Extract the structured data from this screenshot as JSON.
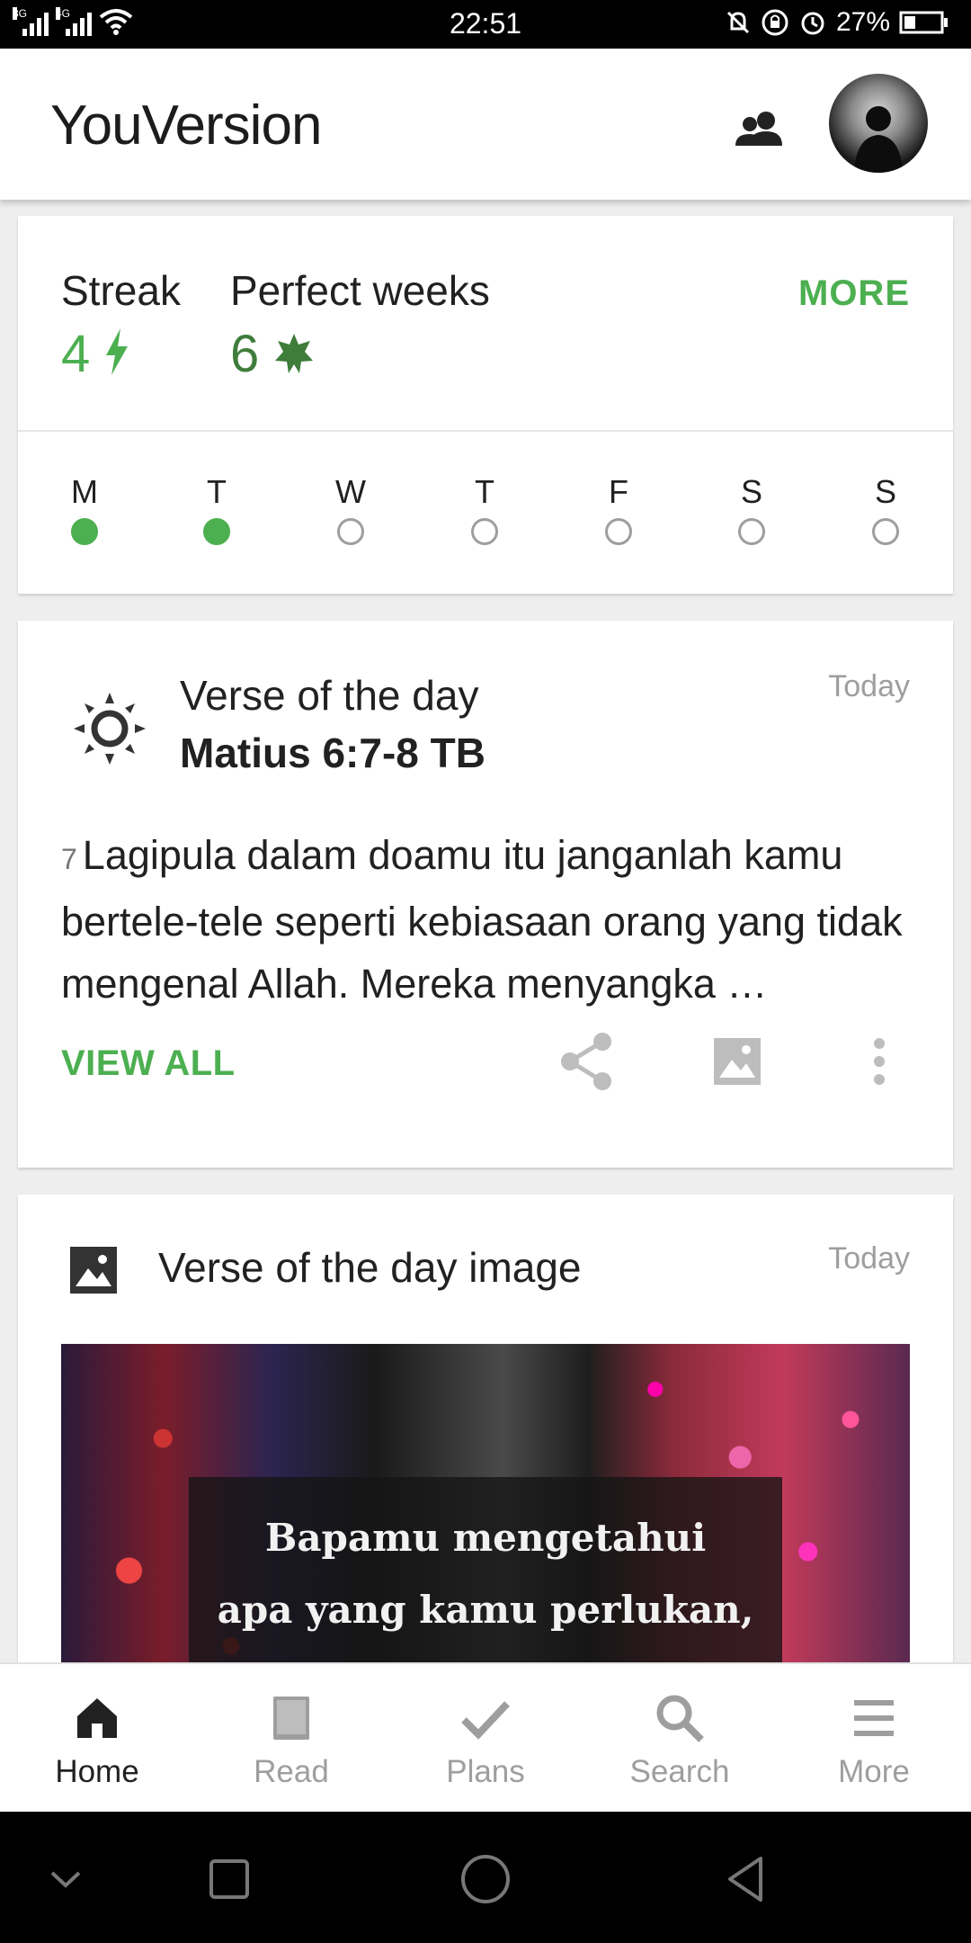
{
  "status_bar": {
    "time": "22:51",
    "network_1": "3G",
    "network_2": "4G",
    "battery": "27%",
    "icons": [
      "signal-icon",
      "wifi-icon",
      "mute-icon",
      "lock-rotation-icon",
      "alarm-icon",
      "battery-icon"
    ]
  },
  "app_bar": {
    "logo": "YouVersion",
    "icons": [
      "friends-icon",
      "avatar"
    ]
  },
  "streak_card": {
    "streak_label": "Streak",
    "streak_value": "4",
    "perfect_label": "Perfect weeks",
    "perfect_value": "6",
    "more_label": "MORE",
    "days": [
      {
        "letter": "M",
        "done": true
      },
      {
        "letter": "T",
        "done": true
      },
      {
        "letter": "W",
        "done": false
      },
      {
        "letter": "T",
        "done": false
      },
      {
        "letter": "F",
        "done": false
      },
      {
        "letter": "S",
        "done": false
      },
      {
        "letter": "S",
        "done": false
      }
    ],
    "colors": {
      "accent": "#4caf50",
      "perfect": "#3f7d3a"
    }
  },
  "verse_card": {
    "title": "Verse of the day",
    "reference": "Matius 6:7-8 TB",
    "date": "Today",
    "verse_number": "7",
    "verse_text": "Lagipula dalam doamu itu janganlah kamu bertele-tele seperti kebiasaan orang yang tidak mengenal Allah. Mereka menyangka …",
    "view_all_label": "VIEW ALL",
    "actions": [
      "share-icon",
      "image-icon",
      "more-vert-icon"
    ]
  },
  "image_card": {
    "title": "Verse of the day image",
    "date": "Today",
    "image_line_1": "Bapamu mengetahui",
    "image_line_2": "apa yang kamu perlukan,"
  },
  "bottom_nav": {
    "items": [
      {
        "label": "Home",
        "icon": "home-icon",
        "active": true
      },
      {
        "label": "Read",
        "icon": "book-icon",
        "active": false
      },
      {
        "label": "Plans",
        "icon": "check-icon",
        "active": false
      },
      {
        "label": "Search",
        "icon": "search-icon",
        "active": false
      },
      {
        "label": "More",
        "icon": "menu-icon",
        "active": false
      }
    ]
  },
  "system_nav": [
    "collapse-icon",
    "recents-icon",
    "home-circle-icon",
    "back-icon"
  ]
}
